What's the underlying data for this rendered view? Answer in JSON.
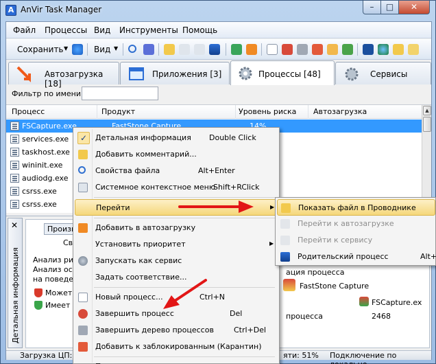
{
  "window": {
    "title": "AnVir Task Manager",
    "minimize": "–",
    "maximize": "□",
    "close": "✕"
  },
  "menubar": [
    "Файл",
    "Процессы",
    "Вид",
    "Инструменты",
    "Помощь"
  ],
  "toolbar": {
    "save_label": "Сохранить",
    "view_label": "Вид"
  },
  "tabs": [
    {
      "label": "Автозагрузка [18]",
      "icon": "startup-arrow-icon"
    },
    {
      "label": "Приложения [3]",
      "icon": "windows-icon"
    },
    {
      "label": "Процессы [48]",
      "icon": "gears-icon",
      "active": true
    },
    {
      "label": "Сервисы",
      "icon": "services-gear-icon"
    }
  ],
  "filter": {
    "label": "Фильтр по имени:",
    "value": ""
  },
  "table": {
    "columns": [
      "Процесс",
      "Продукт",
      "Уровень риска",
      "Автозагрузка"
    ],
    "rows": [
      {
        "name": "FSCapture.exe",
        "product": "FastStone Capture",
        "risk": "14%",
        "selected": true
      },
      {
        "name": "services.exe",
        "product": "",
        "risk": ""
      },
      {
        "name": "taskhost.exe",
        "product": "",
        "risk": ""
      },
      {
        "name": "wininit.exe",
        "product": "",
        "risk": ""
      },
      {
        "name": "audiodg.exe",
        "product": "",
        "risk": ""
      },
      {
        "name": "csrss.exe",
        "product": "",
        "risk": ""
      },
      {
        "name": "csrss.exe",
        "product": "",
        "risk": ""
      }
    ]
  },
  "detail": {
    "side_label": "Детальная информация",
    "close": "✕",
    "tab_label": "Произв",
    "sub_label": "Сво",
    "analysis_title": "Анализ рис",
    "analysis_line1": "Анализ осно",
    "analysis_line2": "на поведени",
    "risk1": "Может и",
    "risk2": "Имеет в",
    "right_header": "ация процесса",
    "product_name": "FastStone Capture",
    "file_name": "FSCapture.ex",
    "pid_label": "процесса",
    "pid_value": "2468"
  },
  "statusbar": {
    "cpu": "Загрузка ЦП: 3%",
    "mem": "яти: 51%",
    "net": "Подключение по локально"
  },
  "context_menu": [
    {
      "label": "Детальная информация",
      "shortcut": "Double Click",
      "checked": true
    },
    {
      "label": "Добавить комментарий...",
      "shortcut": ""
    },
    {
      "label": "Свойства файла",
      "shortcut": "Alt+Enter"
    },
    {
      "label": "Системное контекстное меню",
      "shortcut": "Shift+RClick"
    },
    {
      "label": "Перейти",
      "shortcut": "",
      "submenu": true,
      "hover": true
    },
    {
      "label": "Добавить в автозагрузку",
      "shortcut": ""
    },
    {
      "label": "Установить приоритет",
      "shortcut": "",
      "submenu": true
    },
    {
      "label": "Запускать как сервис",
      "shortcut": ""
    },
    {
      "label": "Задать соответствие...",
      "shortcut": ""
    },
    {
      "label": "Новый процесс...",
      "shortcut": "Ctrl+N"
    },
    {
      "label": "Завершить процесс",
      "shortcut": "Del"
    },
    {
      "label": "Завершить дерево процессов",
      "shortcut": "Ctrl+Del"
    },
    {
      "label": "Добавить к заблокированным (Карантин)",
      "shortcut": ""
    },
    {
      "label": "П",
      "shortcut": ""
    }
  ],
  "submenu": [
    {
      "label": "Показать файл в Проводнике",
      "shortcut": "",
      "hover": true
    },
    {
      "label": "Перейти к автозагрузке",
      "shortcut": "",
      "disabled": true
    },
    {
      "label": "Перейти к сервису",
      "shortcut": "",
      "disabled": true
    },
    {
      "label": "Родительский процесс",
      "shortcut": "Alt+"
    }
  ],
  "colors": {
    "selection": "#3399ff",
    "hover": "#f5d77a",
    "arrow": "#e21616"
  }
}
